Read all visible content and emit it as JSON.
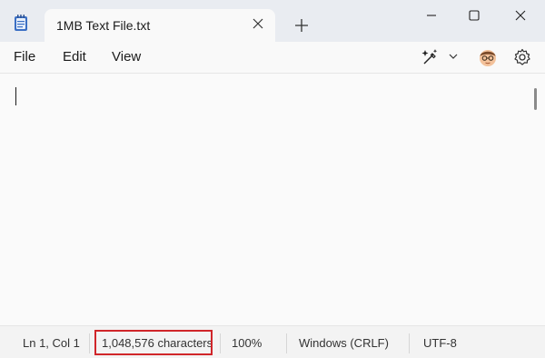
{
  "tab": {
    "title": "1MB Text File.txt"
  },
  "menu": {
    "file": "File",
    "edit": "Edit",
    "view": "View"
  },
  "status": {
    "position": "Ln 1, Col 1",
    "characters": "1,048,576 characters",
    "zoom": "100%",
    "line_ending": "Windows (CRLF)",
    "encoding": "UTF-8"
  },
  "icons": {
    "app": "notepad-icon",
    "tab_close": "close-icon",
    "new_tab": "plus-icon",
    "minimize": "minimize-icon",
    "maximize": "maximize-icon",
    "close": "close-icon",
    "copilot": "copilot-icon",
    "dropdown": "chevron-down-icon",
    "account": "avatar-icon",
    "settings": "gear-icon"
  },
  "colors": {
    "highlight_border": "#d0262a",
    "titlebar": "#e9ecf1",
    "editor_bg": "#fafafa"
  }
}
